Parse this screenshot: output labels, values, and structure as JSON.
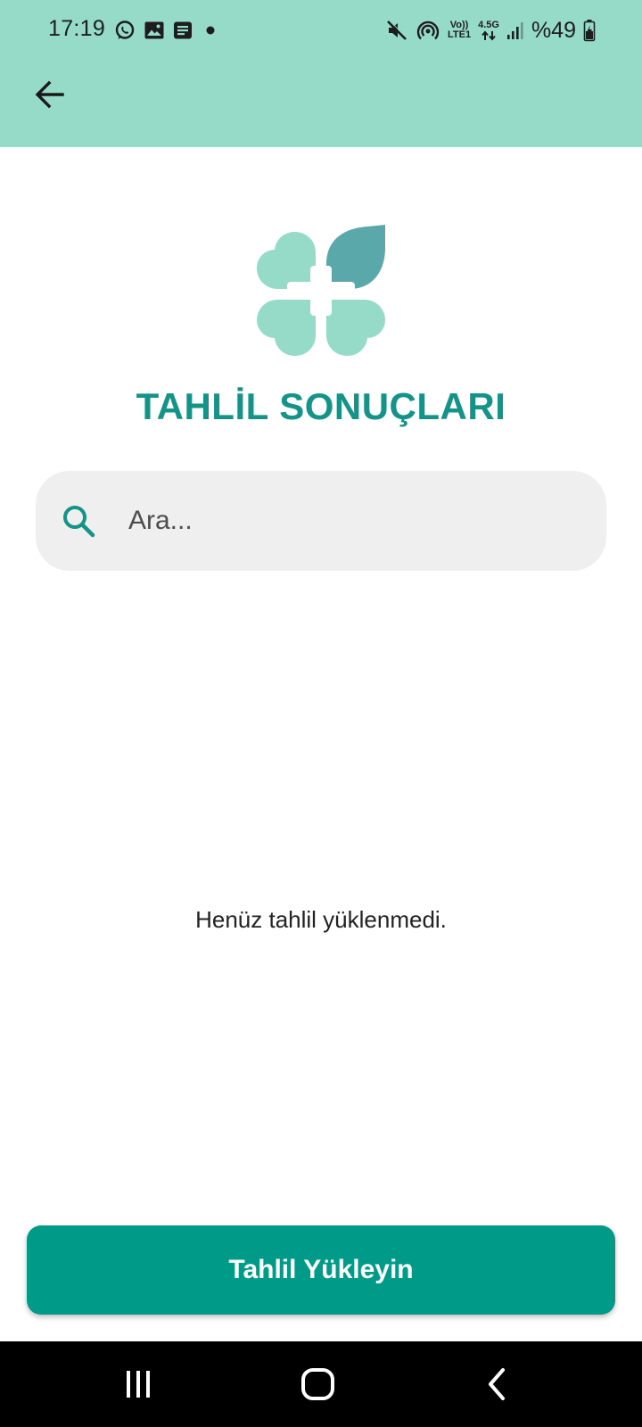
{
  "status_bar": {
    "time": "17:19",
    "left_icons": [
      "whatsapp-icon",
      "gallery-icon",
      "message-icon",
      "dot-icon"
    ],
    "right_icons": [
      "mute-icon",
      "hotspot-icon",
      "volte-icon",
      "network-4g-icon",
      "signal-icon",
      "battery-icon"
    ],
    "network_top": "Vo))",
    "network_bottom": "LTE1",
    "data_type": "4.5G",
    "battery": "%49"
  },
  "app_bar": {
    "back_icon": "arrow-left-icon"
  },
  "logo": {
    "icon": "clover-cross-logo"
  },
  "page_title": "TAHLİL SONUÇLARI",
  "search": {
    "placeholder": "Ara...",
    "value": ""
  },
  "empty_state": "Henüz tahlil yüklenmedi.",
  "upload_button_label": "Tahlil Yükleyin",
  "nav_bar": {
    "items": [
      "recent-apps-icon",
      "home-icon",
      "back-icon"
    ]
  },
  "colors": {
    "header_bg": "#96dbc8",
    "title": "#149488",
    "button_bg": "#009a89",
    "logo_light": "#96dbc8",
    "logo_dark": "#5aa8a9",
    "search_bg": "#efefef"
  }
}
